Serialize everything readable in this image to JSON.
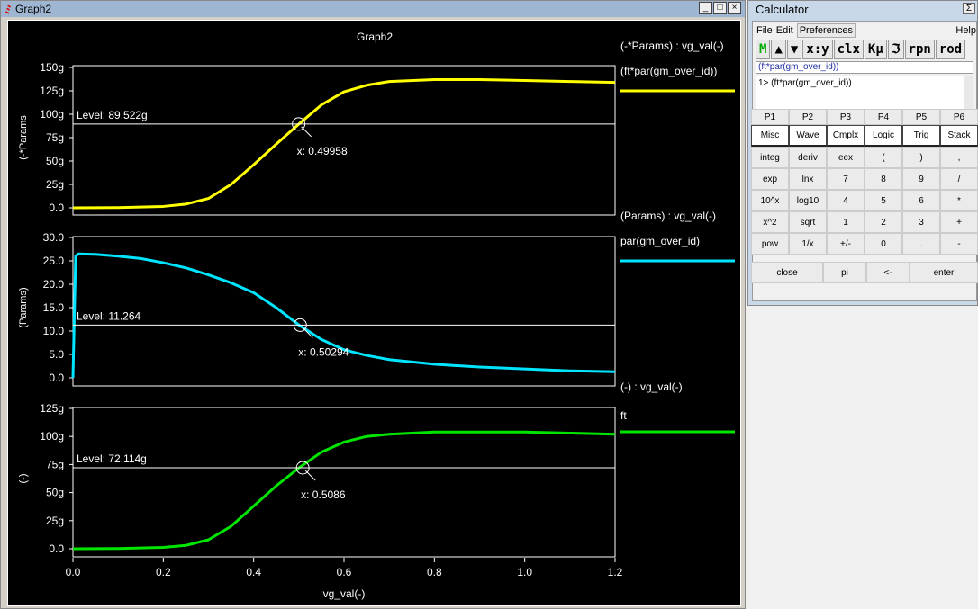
{
  "graph_window": {
    "title": "Graph2",
    "controls": [
      "_",
      "□",
      "×"
    ]
  },
  "graph": {
    "title": "Graph2",
    "xlabel": "vg_val(-)",
    "xticks": [
      "0.0",
      "0.2",
      "0.4",
      "0.6",
      "0.8",
      "1.0",
      "1.2"
    ]
  },
  "chart_data": [
    {
      "type": "line",
      "title": "(-*Params) : vg_val(-)",
      "ylabel": "(-*Params",
      "legend": "(ft*par(gm_over_id))",
      "color": "#ffff00",
      "xlim": [
        0,
        1.2
      ],
      "ylim": [
        0,
        150
      ],
      "yticks": [
        "0.0",
        "25g",
        "50g",
        "75g",
        "100g",
        "125g",
        "150g"
      ],
      "x": [
        0,
        0.1,
        0.2,
        0.25,
        0.3,
        0.35,
        0.4,
        0.45,
        0.5,
        0.55,
        0.6,
        0.65,
        0.7,
        0.8,
        0.9,
        1.0,
        1.1,
        1.2
      ],
      "y": [
        0,
        0.3,
        1.5,
        4,
        10,
        25,
        46,
        68,
        89.5,
        110,
        124,
        131,
        135,
        137,
        137,
        136,
        135,
        134
      ],
      "marker": {
        "level": "Level: 89.522g",
        "level_value": 89.522,
        "x_label": "x: 0.49958",
        "x_value": 0.49958
      }
    },
    {
      "type": "line",
      "title": "(Params) : vg_val(-)",
      "ylabel": "(Params)",
      "legend": "par(gm_over_id)",
      "color": "#00e5ff",
      "xlim": [
        0,
        1.2
      ],
      "ylim": [
        0,
        30
      ],
      "yticks": [
        "0.0",
        "5.0",
        "10.0",
        "15.0",
        "20.0",
        "25.0",
        "30.0"
      ],
      "x": [
        0,
        0.006,
        0.012,
        0.05,
        0.1,
        0.15,
        0.2,
        0.25,
        0.3,
        0.35,
        0.4,
        0.45,
        0.5,
        0.55,
        0.6,
        0.65,
        0.7,
        0.8,
        0.9,
        1.0,
        1.1,
        1.2
      ],
      "y": [
        0,
        26,
        26.5,
        26.4,
        26,
        25.5,
        24.6,
        23.5,
        22,
        20.3,
        18.2,
        15,
        11.3,
        8.2,
        6,
        4.8,
        3.9,
        2.9,
        2.3,
        1.9,
        1.5,
        1.3
      ],
      "marker": {
        "level": "Level: 11.264",
        "level_value": 11.264,
        "x_label": "x: 0.50294",
        "x_value": 0.50294
      }
    },
    {
      "type": "line",
      "title": "(-) : vg_val(-)",
      "ylabel": "(-)",
      "legend": "ft",
      "color": "#00e600",
      "xlim": [
        0,
        1.2
      ],
      "ylim": [
        0,
        125
      ],
      "yticks": [
        "0.0",
        "25g",
        "50g",
        "75g",
        "100g",
        "125g"
      ],
      "x": [
        0,
        0.1,
        0.2,
        0.25,
        0.3,
        0.35,
        0.4,
        0.45,
        0.5,
        0.55,
        0.6,
        0.65,
        0.7,
        0.8,
        0.9,
        1.0,
        1.1,
        1.2
      ],
      "y": [
        0,
        0.2,
        1.2,
        3,
        8,
        20,
        38,
        56,
        72,
        86,
        95,
        100,
        102,
        104,
        104,
        104,
        103,
        102
      ],
      "marker": {
        "level": "Level: 72.114g",
        "level_value": 72.114,
        "x_label": "x: 0.5086",
        "x_value": 0.5086
      }
    }
  ],
  "calculator": {
    "title": "Calculator",
    "close": "Σ",
    "menu": [
      "File",
      "Edit",
      "Preferences",
      "Help"
    ],
    "toolbar": [
      "M",
      "▲",
      "▼",
      "x:y",
      "clx",
      "Kμ",
      "ℑ",
      "rpn",
      "rod"
    ],
    "expression": "(ft*par(gm_over_id))",
    "stack": "1> (ft*par(gm_over_id))",
    "keys": [
      "P1",
      "P2",
      "P3",
      "P4",
      "P5",
      "P6",
      "Misc",
      "Wave",
      "Cmplx",
      "Logic",
      "Trig",
      "Stack",
      "integ",
      "deriv",
      "eex",
      "(",
      ")",
      ",",
      "exp",
      "lnx",
      "7",
      "8",
      "9",
      "/",
      "10^x",
      "log10",
      "4",
      "5",
      "6",
      "*",
      "x^2",
      "sqrt",
      "1",
      "2",
      "3",
      "+",
      "pow",
      "1/x",
      "+/-",
      "0",
      ".",
      "-"
    ],
    "bottom": [
      "close",
      "pi",
      "<-",
      "enter"
    ]
  }
}
